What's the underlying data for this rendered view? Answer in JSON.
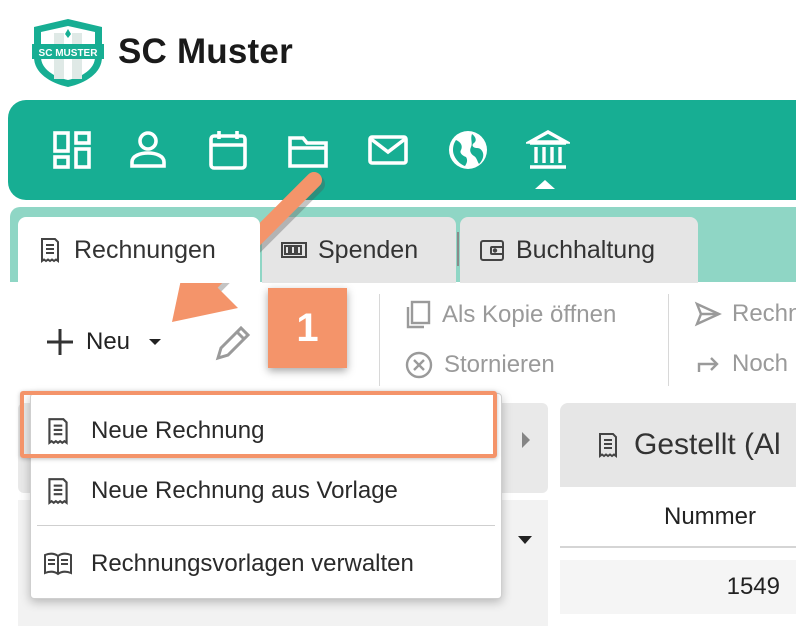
{
  "app": {
    "title": "SC Muster",
    "logo_text": "SC MUSTER"
  },
  "nav": {
    "icons": [
      "dashboard-icon",
      "person-icon",
      "calendar-icon",
      "folder-icon",
      "mail-icon",
      "globe-icon",
      "bank-icon"
    ],
    "active": "bank-icon"
  },
  "tabs": [
    {
      "label": "Rechnungen",
      "icon": "invoice-icon",
      "active": true
    },
    {
      "label": "Spenden",
      "icon": "cash-icon",
      "active": false
    },
    {
      "label": "Buchhaltung",
      "icon": "wallet-icon",
      "active": false
    }
  ],
  "toolbar": {
    "new_label": "Neu",
    "copy_label": "Als Kopie öffnen",
    "cancel_label": "Stornieren",
    "send_label": "Rechn",
    "again_label": "Noch"
  },
  "step_badge": "1",
  "dropdown": {
    "items": [
      {
        "label": "Neue Rechnung",
        "icon": "invoice-icon"
      },
      {
        "label": "Neue Rechnung aus Vorlage",
        "icon": "invoice-icon"
      },
      {
        "label": "Rechnungsvorlagen verwalten",
        "icon": "book-icon"
      }
    ]
  },
  "table": {
    "panel_title": "Gestellt (Al",
    "column_header": "Nummer",
    "first_value": "1549"
  },
  "colors": {
    "brand": "#17ae93",
    "brand_light": "#8fd6c5",
    "annotation": "#f4946a"
  }
}
